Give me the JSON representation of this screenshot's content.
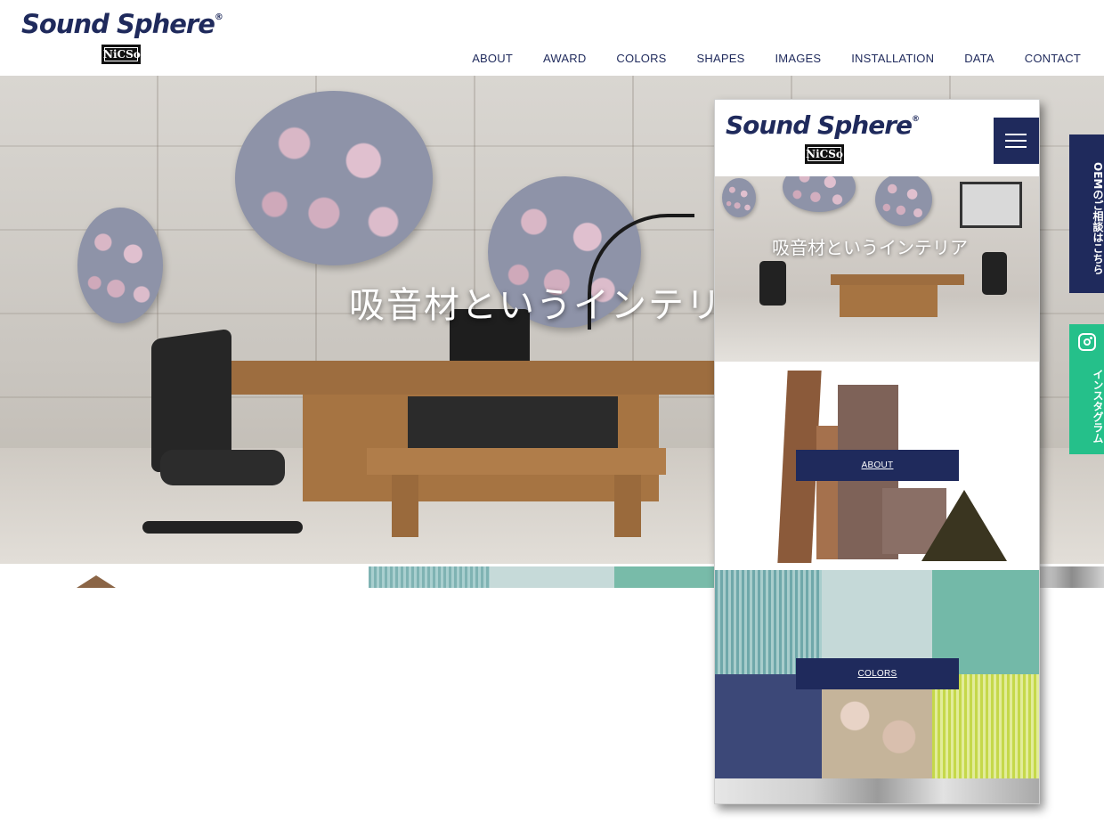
{
  "brand": {
    "name": "Sound Sphere",
    "registered_mark": "®",
    "sub_brand": "NiCSo",
    "color": "#1f2a5c"
  },
  "nav": {
    "items": [
      "ABOUT",
      "AWARD",
      "COLORS",
      "SHAPES",
      "IMAGES",
      "INSTALLATION",
      "DATA",
      "CONTACT"
    ]
  },
  "hero": {
    "title": "吸音材というインテリア"
  },
  "side_tabs": {
    "oem": {
      "label": "OEMのご相談はこちら",
      "color": "#1f2a5c"
    },
    "instagram": {
      "label": "インスタグラム",
      "icon": "instagram-icon",
      "color": "#25c08a"
    }
  },
  "mobile_preview": {
    "menu_icon": "hamburger-menu-icon",
    "hero_title": "吸音材というインテリア",
    "sections": {
      "about": "ABOUT",
      "colors": "COLORS"
    }
  }
}
